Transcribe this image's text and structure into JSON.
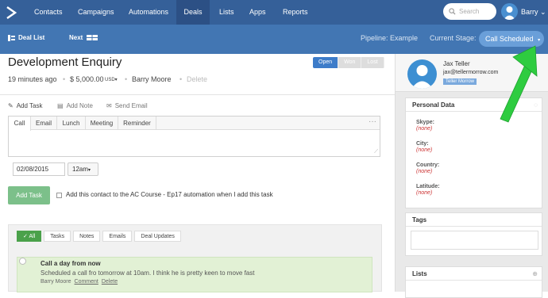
{
  "topnav": {
    "items": [
      "Contacts",
      "Campaigns",
      "Automations",
      "Deals",
      "Lists",
      "Apps",
      "Reports"
    ],
    "active": "Deals",
    "search_placeholder": "Search",
    "user": "Barry"
  },
  "subbar": {
    "deal_list": "Deal List",
    "next": "Next",
    "pipeline": "Pipeline: Example",
    "stage_label": "Current Stage:",
    "stage_value": "Call Scheduled"
  },
  "deal": {
    "title": "Development Enquiry",
    "time": "19 minutes ago",
    "value": "$ 5,000.00",
    "currency": "USD",
    "owner": "Barry Moore",
    "delete": "Delete",
    "status": [
      "Open",
      "Won",
      "Lost"
    ],
    "active_status": "Open"
  },
  "actions": {
    "add_task": "Add Task",
    "add_note": "Add Note",
    "send_email": "Send Email"
  },
  "task": {
    "tabs": [
      "Call",
      "Email",
      "Lunch",
      "Meeting",
      "Reminder"
    ],
    "active_tab": "Call",
    "date": "02/08/2015",
    "time": "12am",
    "add_button": "Add Task",
    "automation_label": "Add this contact to the AC Course - Ep17 automation when I add this task"
  },
  "activity": {
    "filters": [
      "All",
      "Tasks",
      "Notes",
      "Emails",
      "Deal Updates"
    ],
    "active_filter": "All",
    "item": {
      "title": "Call a day from now",
      "body": "Scheduled a call fro tomorrow at 10am. I think he is pretty keen to move fast",
      "author": "Barry Moore",
      "comment": "Comment",
      "delete": "Delete"
    }
  },
  "contact": {
    "name": "Jax Teller",
    "email": "jax@tellermorrow.com",
    "company": "Teller Morrow"
  },
  "personal_data": {
    "heading": "Personal Data",
    "fields": [
      {
        "label": "Skype:",
        "value": "(none)"
      },
      {
        "label": "City:",
        "value": "(none)"
      },
      {
        "label": "Country:",
        "value": "(none)"
      },
      {
        "label": "Latitude:",
        "value": "(none)"
      }
    ]
  },
  "tags": {
    "heading": "Tags"
  },
  "lists": {
    "heading": "Lists"
  },
  "colors": {
    "nav": "#356099",
    "subbar": "#4276b3",
    "primary": "#3d7cc9",
    "green": "#4aa14a",
    "arrow": "#2ecc40"
  }
}
